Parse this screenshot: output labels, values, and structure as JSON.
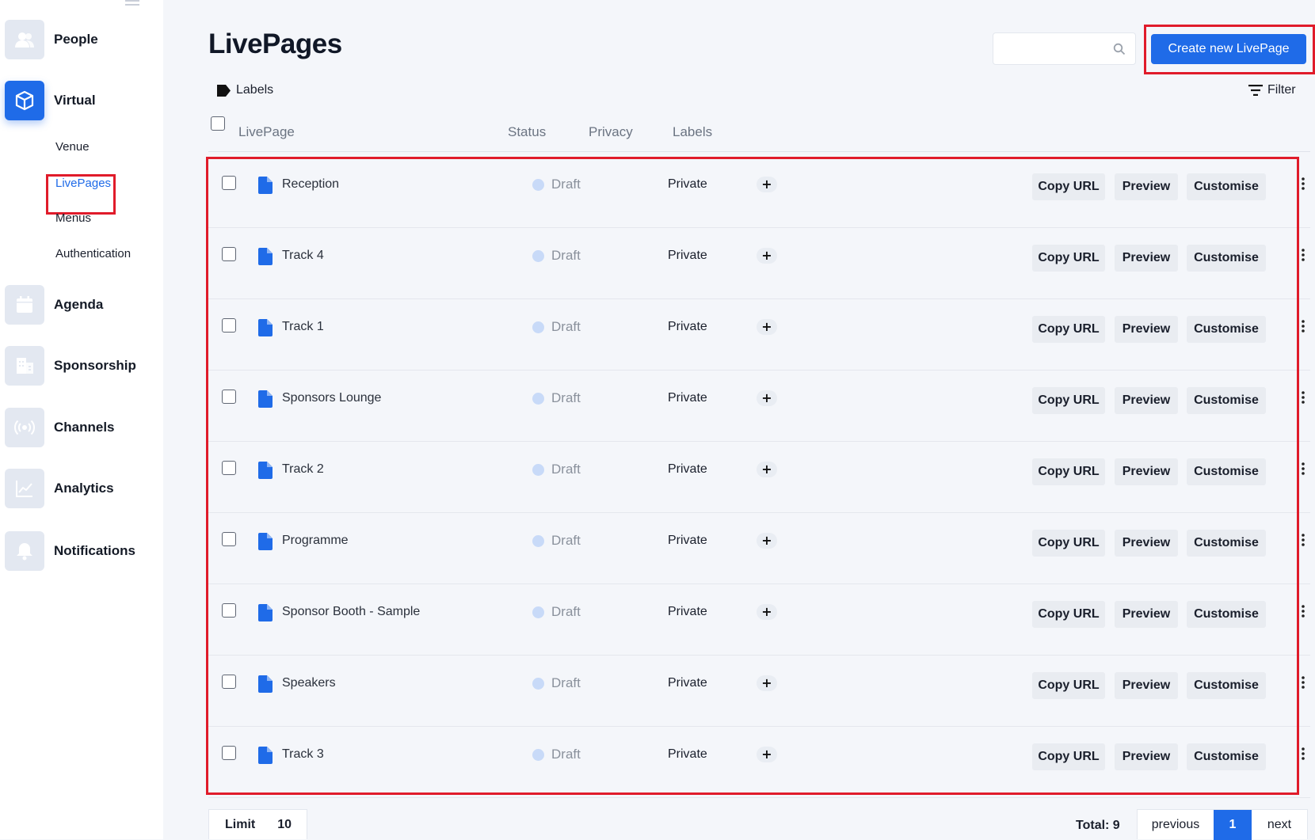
{
  "sidebar": {
    "items": [
      {
        "label": "People",
        "icon": "people-icon"
      },
      {
        "label": "Virtual",
        "icon": "cube-icon",
        "active": true
      },
      {
        "label": "Agenda",
        "icon": "calendar-icon"
      },
      {
        "label": "Sponsorship",
        "icon": "building-icon"
      },
      {
        "label": "Channels",
        "icon": "broadcast-icon"
      },
      {
        "label": "Analytics",
        "icon": "chart-icon"
      },
      {
        "label": "Notifications",
        "icon": "bell-icon"
      }
    ],
    "subitems": [
      {
        "label": "Venue"
      },
      {
        "label": "LivePages",
        "active": true
      },
      {
        "label": "Menus"
      },
      {
        "label": "Authentication"
      }
    ]
  },
  "header": {
    "title": "LivePages",
    "search_placeholder": "",
    "create_label": "Create new LivePage"
  },
  "toolbar": {
    "labels_label": "Labels",
    "filter_label": "Filter"
  },
  "table": {
    "columns": [
      "LivePage",
      "Status",
      "Privacy",
      "Labels"
    ],
    "action_labels": {
      "copy": "Copy URL",
      "preview": "Preview",
      "customise": "Customise",
      "add_label": "+"
    },
    "rows": [
      {
        "name": "Reception",
        "status": "Draft",
        "privacy": "Private"
      },
      {
        "name": "Track 4",
        "status": "Draft",
        "privacy": "Private"
      },
      {
        "name": "Track 1",
        "status": "Draft",
        "privacy": "Private"
      },
      {
        "name": "Sponsors Lounge",
        "status": "Draft",
        "privacy": "Private"
      },
      {
        "name": "Track 2",
        "status": "Draft",
        "privacy": "Private"
      },
      {
        "name": "Programme",
        "status": "Draft",
        "privacy": "Private"
      },
      {
        "name": "Sponsor Booth - Sample",
        "status": "Draft",
        "privacy": "Private"
      },
      {
        "name": "Speakers",
        "status": "Draft",
        "privacy": "Private"
      },
      {
        "name": "Track 3",
        "status": "Draft",
        "privacy": "Private"
      }
    ]
  },
  "footer": {
    "limit_label": "Limit",
    "limit_value": "10",
    "total": "Total: 9",
    "previous": "previous",
    "page": "1",
    "next": "next"
  },
  "colors": {
    "accent": "#1f6be8",
    "highlight": "#e01b2a",
    "draft_dot": "#c8daf8"
  }
}
